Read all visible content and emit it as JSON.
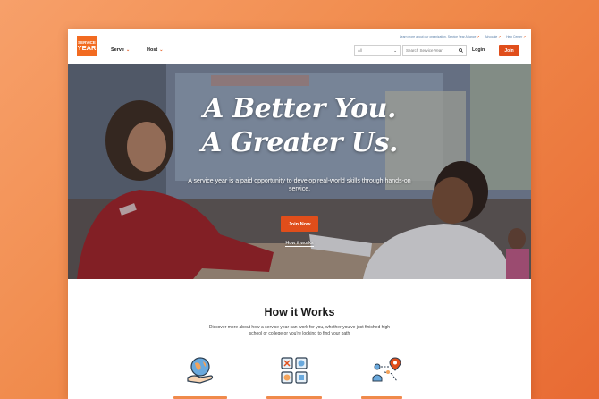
{
  "header": {
    "logo_line1": "SERVICE",
    "logo_line2": "YEAR",
    "nav": [
      {
        "label": "Serve"
      },
      {
        "label": "Host"
      }
    ],
    "top_links": [
      {
        "label": "Learn more about our organization, Service Year Alliance"
      },
      {
        "label": "Advocate"
      },
      {
        "label": "Help Center"
      }
    ],
    "category_select": "All",
    "search_placeholder": "Search Service Year",
    "login_label": "Login",
    "join_label": "Join"
  },
  "hero": {
    "headline_line1": "A Better You.",
    "headline_line2": "A Greater Us.",
    "subtext": "A service year is a paid opportunity to develop real-world skills through hands-on service.",
    "join_button": "Join Now",
    "how_link": "How it works"
  },
  "how_it_works": {
    "title": "How it Works",
    "description": "Discover more about how a service year can work for you, whether you've just finished high school or college or you're looking to find your path"
  },
  "colors": {
    "brand_orange": "#e04e1b",
    "background_gradient_start": "#f7a06a",
    "background_gradient_end": "#e86a33",
    "link_blue": "#5a7fa8"
  },
  "icons": [
    "globe-hand-icon",
    "grid-tiles-icon",
    "map-route-icon",
    "search-icon",
    "external-link-icon",
    "chevron-down-icon"
  ]
}
